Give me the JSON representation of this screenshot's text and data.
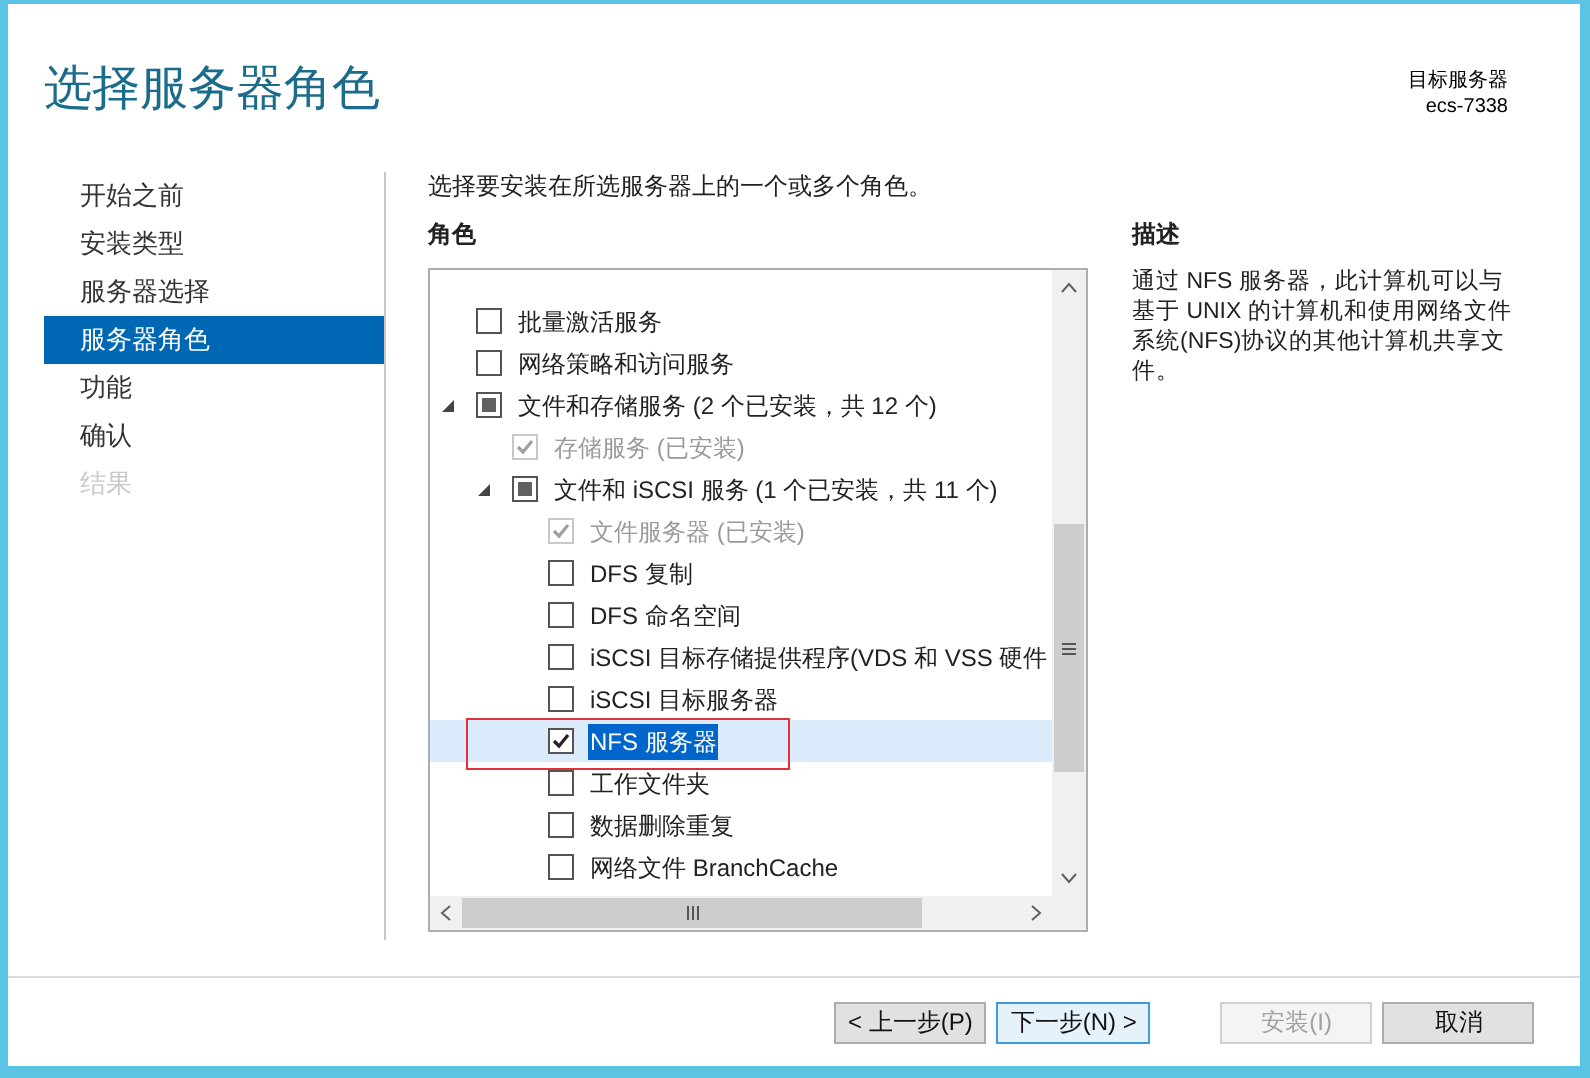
{
  "window": {
    "title": "选择服务器角色"
  },
  "target_server": {
    "label": "目标服务器",
    "name": "ecs-7338"
  },
  "nav": [
    {
      "label": "开始之前",
      "selected": false,
      "disabled": false
    },
    {
      "label": "安装类型",
      "selected": false,
      "disabled": false
    },
    {
      "label": "服务器选择",
      "selected": false,
      "disabled": false
    },
    {
      "label": "服务器角色",
      "selected": true,
      "disabled": false
    },
    {
      "label": "功能",
      "selected": false,
      "disabled": false
    },
    {
      "label": "确认",
      "selected": false,
      "disabled": false
    },
    {
      "label": "结果",
      "selected": false,
      "disabled": true
    }
  ],
  "instruction": "选择要安装在所选服务器上的一个或多个角色。",
  "roles": {
    "heading": "角色",
    "items": [
      {
        "label": "批量激活服务",
        "kind": "unchecked",
        "disabled": false,
        "selected": false,
        "highlighted": false
      },
      {
        "label": "网络策略和访问服务",
        "kind": "unchecked",
        "disabled": false,
        "selected": false,
        "highlighted": false
      },
      {
        "label": "文件和存储服务 (2 个已安装，共 12 个)",
        "kind": "partial",
        "disabled": false,
        "selected": false,
        "highlighted": false,
        "expanded": true,
        "children": [
          {
            "label": "存储服务 (已安装)",
            "kind": "checked",
            "disabled": true,
            "selected": false,
            "highlighted": false
          },
          {
            "label": "文件和 iSCSI 服务 (1 个已安装，共 11 个)",
            "kind": "partial",
            "disabled": false,
            "selected": false,
            "highlighted": false,
            "expanded": true,
            "children": [
              {
                "label": "文件服务器 (已安装)",
                "kind": "checked",
                "disabled": true,
                "selected": false,
                "highlighted": false
              },
              {
                "label": "DFS 复制",
                "kind": "unchecked",
                "disabled": false,
                "selected": false,
                "highlighted": false
              },
              {
                "label": "DFS 命名空间",
                "kind": "unchecked",
                "disabled": false,
                "selected": false,
                "highlighted": false
              },
              {
                "label": "iSCSI 目标存储提供程序(VDS 和 VSS 硬件",
                "kind": "unchecked",
                "disabled": false,
                "selected": false,
                "highlighted": false
              },
              {
                "label": "iSCSI 目标服务器",
                "kind": "unchecked",
                "disabled": false,
                "selected": false,
                "highlighted": false
              },
              {
                "label": "NFS 服务器",
                "kind": "checked",
                "disabled": false,
                "selected": true,
                "highlighted": true
              },
              {
                "label": "工作文件夹",
                "kind": "unchecked",
                "disabled": false,
                "selected": false,
                "highlighted": false
              },
              {
                "label": "数据删除重复",
                "kind": "unchecked",
                "disabled": false,
                "selected": false,
                "highlighted": false
              },
              {
                "label": "网络文件 BranchCache",
                "kind": "unchecked",
                "disabled": false,
                "selected": false,
                "highlighted": false
              }
            ]
          }
        ]
      }
    ]
  },
  "description": {
    "heading": "描述",
    "text": "通过 NFS 服务器，此计算机可以与基于 UNIX 的计算机和使用网络文件系统(NFS)协议的其他计算机共享文件。"
  },
  "buttons": [
    {
      "label": "< 上一步(P)",
      "disabled": false,
      "focused": false
    },
    {
      "label": "下一步(N) >",
      "disabled": false,
      "focused": true
    },
    {
      "label": "安装(I)",
      "disabled": true,
      "focused": false
    },
    {
      "label": "取消",
      "disabled": false,
      "focused": false
    }
  ]
}
